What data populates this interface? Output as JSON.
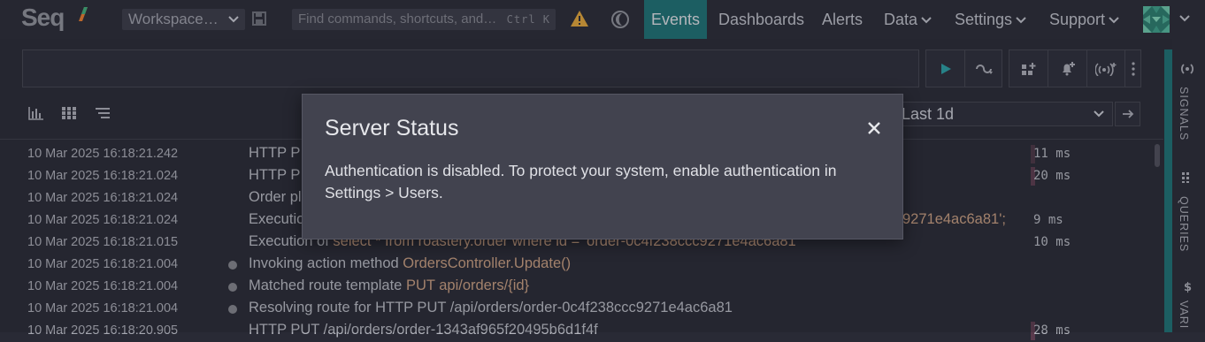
{
  "app": {
    "logo_text": "Seq"
  },
  "header": {
    "workspace": "Workspace…",
    "search_placeholder": "Find commands, shortcuts, and…",
    "search_shortcut": "Ctrl K",
    "nav": [
      {
        "label": "Events",
        "active": true
      },
      {
        "label": "Dashboards"
      },
      {
        "label": "Alerts"
      },
      {
        "label": "Data"
      },
      {
        "label": "Settings"
      },
      {
        "label": "Support"
      }
    ]
  },
  "toolbar": {
    "range": "Last 1d"
  },
  "events": [
    {
      "ts": "10 Mar 2025  16:18:21.242",
      "msg": "HTTP P",
      "dur": "11 ms"
    },
    {
      "ts": "10 Mar 2025  16:18:21.024",
      "msg": "HTTP P",
      "dur": "20 ms"
    },
    {
      "ts": "10 Mar 2025  16:18:21.024",
      "msg": "Order pl",
      "dur": ""
    },
    {
      "ts": "10 Mar 2025  16:18:21.024",
      "msg": "Executio",
      "tail": "9271e4ac6a81';",
      "dur": "9 ms"
    },
    {
      "ts": "10 Mar 2025  16:18:21.015",
      "msg": "Execution of ",
      "prop": "select * from roastery.order where id = 'order-0c4f238ccc9271e4ac6a81'",
      "dur": "10 ms"
    },
    {
      "ts": "10 Mar 2025  16:18:21.004",
      "msg": "Invoking action method ",
      "prop": "OrdersController.Update()",
      "dur": ""
    },
    {
      "ts": "10 Mar 2025  16:18:21.004",
      "msg": "Matched route template ",
      "prop": "PUT api/orders/{id}",
      "dur": ""
    },
    {
      "ts": "10 Mar 2025  16:18:21.004",
      "msg": "Resolving route for HTTP PUT /api/orders/order-0c4f238ccc9271e4ac6a81",
      "dur": ""
    },
    {
      "ts": "10 Mar 2025  16:18:20.905",
      "msg": "HTTP PUT /api/orders/order-1343af965f20495b6d1f4f",
      "dur": "28 ms"
    }
  ],
  "rail": {
    "signals": "SIGNALS",
    "queries": "QUERIES",
    "variables": "VARI"
  },
  "modal": {
    "title": "Server Status",
    "body": "Authentication is disabled. To protect your system, enable authentication in Settings > Users."
  },
  "colors": {
    "accent": "#1e6e72",
    "modal_bg": "#42434f",
    "background": "#292a35"
  }
}
